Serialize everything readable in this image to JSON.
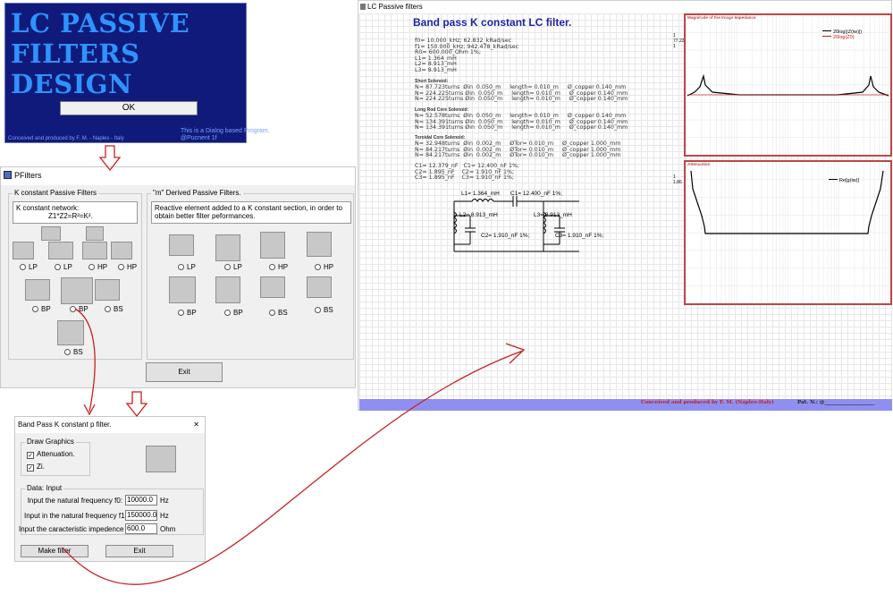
{
  "splash": {
    "lines": [
      "LC PASSIVE",
      "FILTERS",
      "DESIGN"
    ],
    "ok_label": "OK",
    "note1": "This is a Dialog based Program.",
    "note2": "@Pucnent 1f",
    "credit": "Conceived and produced by F. M. - Naples - Italy"
  },
  "pfilters": {
    "title": "PFilters",
    "k_group": "K constant Passive Filters",
    "k_info_1": "K constant network:",
    "k_info_2": "Z1*Z2=R²=K².",
    "m_group": "\"m\" Derived Passive Filters.",
    "m_info": "Reactive element added to a K constant section, in order to obtain better filter peformances.",
    "k_radios": [
      "LP",
      "LP",
      "HP",
      "HP",
      "BP",
      "BP",
      "BS",
      "BS"
    ],
    "m_radios": [
      "LP",
      "LP",
      "HP",
      "HP",
      "BP",
      "BP",
      "BS",
      "BS"
    ],
    "exit_label": "Exit"
  },
  "bpdialog": {
    "title": "Band Pass K constant p filter.",
    "close": "✕",
    "draw_group": "Draw Graphics",
    "attenuation_label": "Attenuation.",
    "zi_label": "Zi.",
    "data_group": "Data: Input",
    "f0_label": "Input the natural frequency f0:",
    "f0_value": "10000.0",
    "f1_label": "Input in the natural frequency f1:",
    "f1_value": "150000.0",
    "z0_label": "Input the caracteristic impedence Z0:",
    "z0_value": "600.0",
    "hz1": "Hz",
    "hz2": "Hz",
    "ohm": "Ohm",
    "make_label": "Make filter",
    "exit_label": "Exit"
  },
  "lc": {
    "title": "LC Passive filters",
    "heading": "Band pass K constant LC filter.",
    "params": "f0= 10.000_kHz; 62.832_kRad/sec\nf1= 150.000_kHz; 942.478_kRad/sec\nR0= 600.000_Ohm 1%;\nL1= 1.364_mH\nL2= 8.913_mH\nL3= 8.913_mH",
    "short_title": "Short Solenoid:",
    "short_rows": "N= 87.723turns  Øin  0.050_m     length= 0.010_m     Ø_copper 0.140_mm\nN= 224.225turns Øin  0.050_m     length= 0.010_m     Ø_copper 0.140_mm\nN= 224.225turns Øin  0.050_m     length= 0.010_m     Ø_copper 0.140_mm",
    "long_title": "Long Rod Core Solenoid:",
    "long_rows": "N= 52.578turns  Øin  0.050_m     length= 0.010_m     Ø_copper 0.140_mm\nN= 134.391turns Øin  0.050_m     length= 0.010_m     Ø_copper 0.140_mm\nN= 134.391turns Øin  0.050_m     length= 0.010_m     Ø_copper 0.140_mm",
    "tor_title": "Toroidal Core Solenoid:",
    "tor_rows": "N= 32.948turns  Øin  0.002_m     ØTor= 0.010_m     Ø_copper 1.000_mm\nN= 84.217turns  Øin  0.002_m     ØTor= 0.010_m     Ø_copper 1.000_mm\nN= 84.217turns  Øin  0.002_m     ØTor= 0.010_m     Ø_copper 1.000_mm",
    "caps": "C1= 12.379_nF   C1= 12.400_nF 1%;\nC2= 1.895_nF    C2= 1.910_nF 1%;\nC3= 1.895_nF    C3= 1.910_nF 1%;",
    "edge_1a": "1",
    "edge_77": "77.22",
    "edge_1b": "1",
    "edge_1c": "1",
    "edge_186": "1.86",
    "schem_l1": "L1= 1.364_mH",
    "schem_c1": "C1= 12.400_nF 1%;",
    "schem_l2": "L2= 8.913_mH",
    "schem_c2": "C2= 1.910_nF 1%;",
    "schem_l3": "L3= 8.913_mH",
    "schem_c3": "C3= 1.910_nF 1%;",
    "graph1_title": "Magnitude of the Image Impedance",
    "graph1_leg1": "20log(|Z(iw)|)",
    "graph1_leg2": "20log(Z0)",
    "graph2_title": "Attenuation",
    "graph2_leg1": "Re[g(iw)]",
    "footer_text": "Conceived and produced by F. M. (Naples-Italy)",
    "footer_pn": "Pat. N.: @____________________",
    "colors": {
      "impedance": "#000000",
      "z0": "#c02020",
      "frame": "#c04545",
      "arrow": "#c82020"
    }
  }
}
